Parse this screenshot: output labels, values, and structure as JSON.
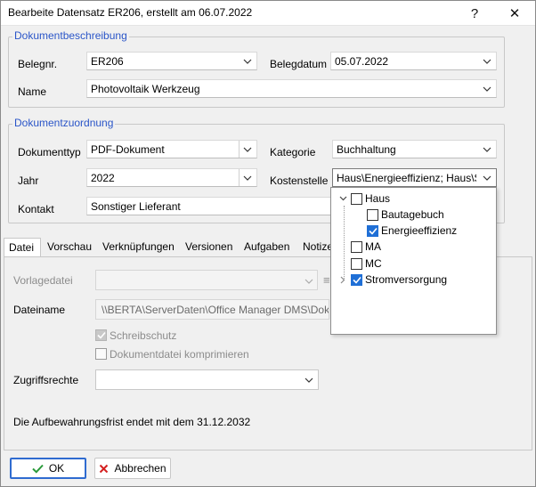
{
  "window": {
    "title": "Bearbeite Datensatz ER206, erstellt am 06.07.2022",
    "help_label": "?",
    "close_label": "✕"
  },
  "dokumentbeschreibung": {
    "legend": "Dokumentbeschreibung",
    "belegnr_label": "Belegnr.",
    "belegnr_value": "ER206",
    "belegdatum_label": "Belegdatum",
    "belegdatum_value": "05.07.2022",
    "name_label": "Name",
    "name_value": "Photovoltaik Werkzeug"
  },
  "dokumentzuordnung": {
    "legend": "Dokumentzuordnung",
    "dokumenttyp_label": "Dokumenttyp",
    "dokumenttyp_value": "PDF-Dokument",
    "kategorie_label": "Kategorie",
    "kategorie_value": "Buchhaltung",
    "jahr_label": "Jahr",
    "jahr_value": "2022",
    "kostenstelle_label": "Kostenstelle",
    "kostenstelle_value": "Haus\\Energieeffizienz; Haus\\St",
    "kontakt_label": "Kontakt",
    "kontakt_value": "Sonstiger Lieferant"
  },
  "tabs": [
    {
      "label": "Datei",
      "active": true
    },
    {
      "label": "Vorschau"
    },
    {
      "label": "Verknüpfungen"
    },
    {
      "label": "Versionen"
    },
    {
      "label": "Aufgaben"
    },
    {
      "label": "Notize"
    }
  ],
  "datei": {
    "vorlagedatei_label": "Vorlagedatei",
    "dateiname_label": "Dateiname",
    "dateiname_value": "\\\\BERTA\\ServerDaten\\Office Manager DMS\\Dokum",
    "schreibschutz_label": "Schreibschutz",
    "schreibschutz_checked": true,
    "komprimieren_label": "Dokumentdatei komprimieren",
    "komprimieren_checked": false,
    "zugriffsrechte_label": "Zugriffsrechte",
    "zugriffsrechte_value": "",
    "aufbewahrung_text": "Die Aufbewahrungsfrist endet mit dem 31.12.2032"
  },
  "kostenstelle_tree": [
    {
      "label": "Haus",
      "checked": false,
      "expanded": true,
      "level": 0
    },
    {
      "label": "Bautagebuch",
      "checked": false,
      "level": 1
    },
    {
      "label": "Energieeffizienz",
      "checked": true,
      "level": 1
    },
    {
      "label": "MA",
      "checked": false,
      "level": 0
    },
    {
      "label": "MC",
      "checked": false,
      "level": 0
    },
    {
      "label": "Stromversorgung",
      "checked": true,
      "expanded": false,
      "level": 0
    }
  ],
  "buttons": {
    "ok_label": "OK",
    "abbrechen_label": "Abbrechen"
  },
  "colors": {
    "legend_blue": "#2a55c8",
    "check_blue": "#1f6fd6",
    "ok_green": "#2a9a3a",
    "cancel_red": "#d42020"
  }
}
